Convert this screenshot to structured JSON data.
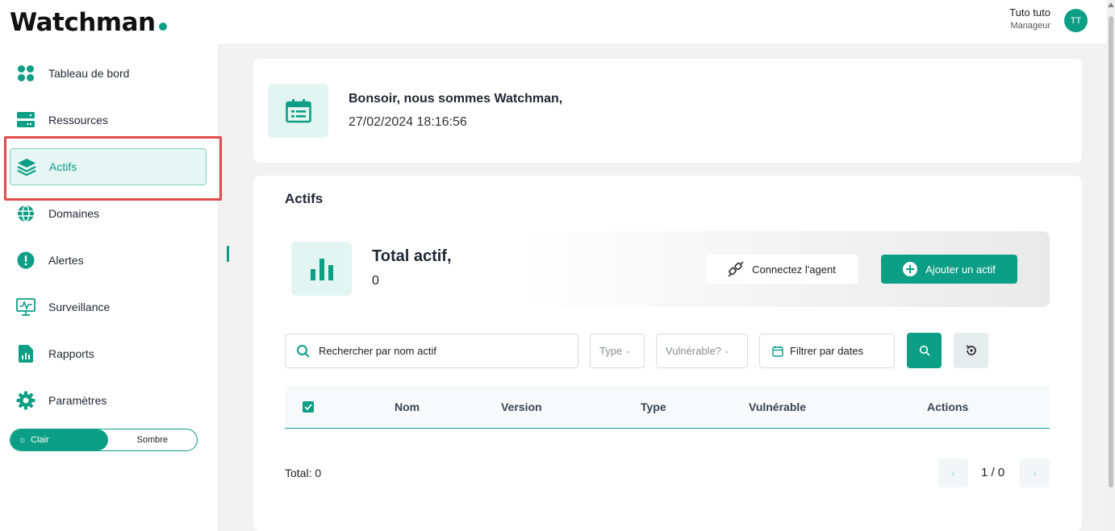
{
  "app": {
    "logo_text": "Watchman",
    "accent_color": "#0d9e86"
  },
  "user": {
    "name": "Tuto tuto",
    "role": "Manageur",
    "initials": "TT"
  },
  "sidebar": {
    "items": [
      {
        "label": "Tableau de bord",
        "icon": "dashboard-grid-icon"
      },
      {
        "label": "Ressources",
        "icon": "server-icon"
      },
      {
        "label": "Actifs",
        "icon": "layers-icon",
        "active": true
      },
      {
        "label": "Domaines",
        "icon": "globe-icon"
      },
      {
        "label": "Alertes",
        "icon": "alert-icon"
      },
      {
        "label": "Surveillance",
        "icon": "monitor-icon"
      },
      {
        "label": "Rapports",
        "icon": "report-icon"
      },
      {
        "label": "Paramètres",
        "icon": "gear-icon"
      }
    ],
    "theme_toggle": {
      "light": "Clair",
      "dark": "Sombre",
      "selected": "Clair"
    }
  },
  "greeting": {
    "title": "Bonsoir, nous sommes Watchman,",
    "datetime": "27/02/2024 18:16:56"
  },
  "main": {
    "title": "Actifs",
    "total_label": "Total actif,",
    "total_count": "0",
    "connect_agent_label": "Connectez l'agent",
    "add_asset_label": "Ajouter un actif",
    "filters": {
      "search_placeholder": "Rechercher par nom actif",
      "type_placeholder": "Type",
      "vulnerable_placeholder": "Vulnérable?",
      "dates_label": "Filtrer par dates"
    },
    "table": {
      "columns": [
        "Nom",
        "Version",
        "Type",
        "Vulnérable",
        "Actions"
      ],
      "rows": []
    },
    "footer": {
      "total_text": "Total: 0",
      "pagination": "1 / 0"
    }
  }
}
